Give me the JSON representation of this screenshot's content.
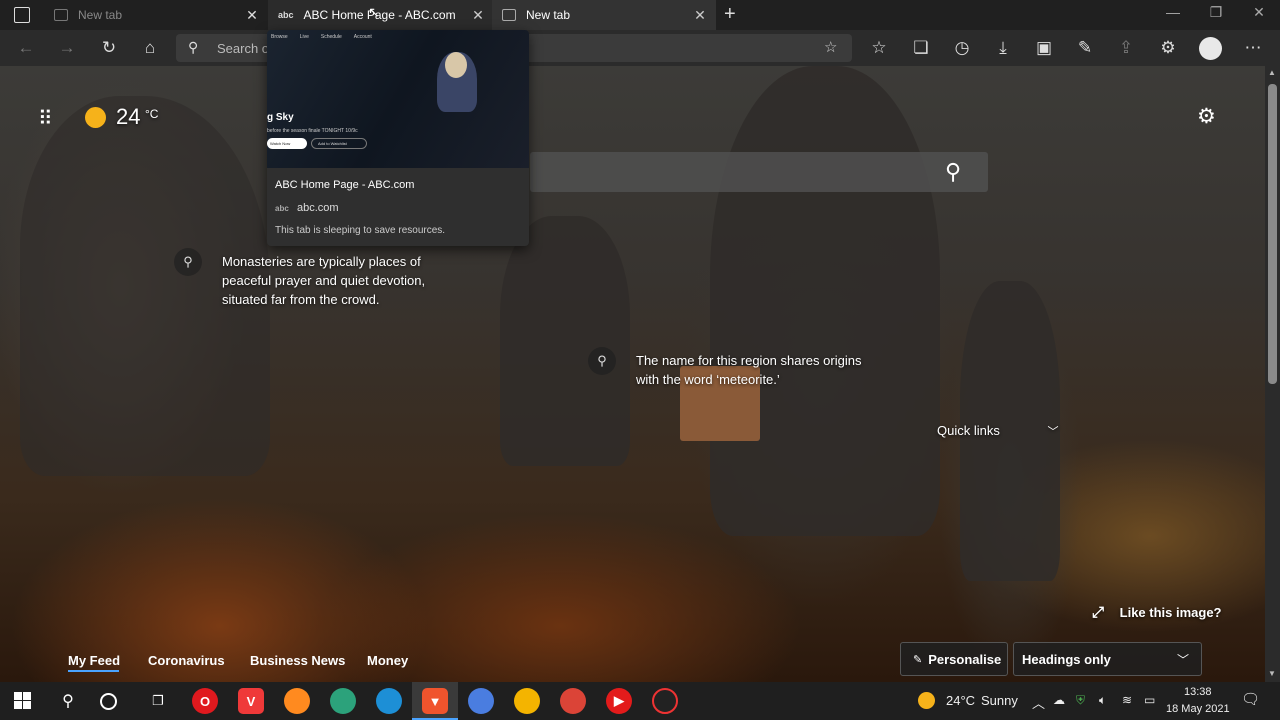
{
  "tabs": [
    {
      "label": "New tab"
    },
    {
      "label": "ABC Home Page - ABC.com"
    },
    {
      "label": "New tab"
    }
  ],
  "address": {
    "placeholder": "Search o"
  },
  "weather": {
    "temp": "24",
    "unit": "°C"
  },
  "preview": {
    "thumb_heading": "g Sky",
    "thumb_caption": "before the season finale TONIGHT 10/9c",
    "thumb_btn1": "Watch Now",
    "thumb_btn2": "Add to Watchlist",
    "nav": [
      "Browse",
      "Live",
      "Schedule",
      "Account"
    ],
    "title": "ABC Home Page - ABC.com",
    "domain": "abc.com",
    "status": "This tab is sleeping to save resources."
  },
  "facts": [
    {
      "text": "Monasteries are typically places of peaceful prayer and quiet devotion, situated far from the crowd."
    },
    {
      "text": "The name for this region shares origins with the word ‘meteorite.’"
    }
  ],
  "quick_links": {
    "label": "Quick links"
  },
  "like_image": {
    "label": "Like this image?"
  },
  "feed": {
    "items": [
      "My Feed",
      "Coronavirus",
      "Business News",
      "Money"
    ],
    "active": "My Feed"
  },
  "personalise": {
    "label": "Personalise"
  },
  "headings": {
    "label": "Headings only"
  },
  "taskbar": {
    "weather_temp": "24°C",
    "weather_cond": "Sunny",
    "time": "13:38",
    "date": "18 May 2021"
  },
  "colors": {
    "accent": "#4aa3ff",
    "weather_sun": "#f6b21a"
  }
}
